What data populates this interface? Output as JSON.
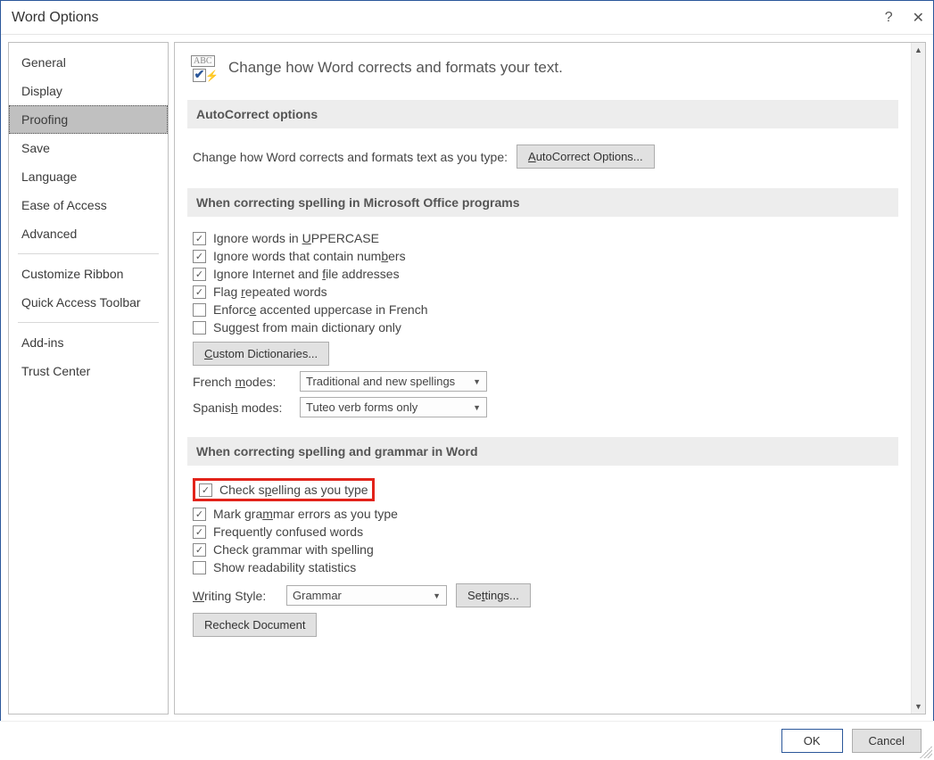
{
  "window": {
    "title": "Word Options"
  },
  "sidebar": {
    "items": [
      {
        "label": "General"
      },
      {
        "label": "Display"
      },
      {
        "label": "Proofing",
        "selected": true
      },
      {
        "label": "Save"
      },
      {
        "label": "Language"
      },
      {
        "label": "Ease of Access"
      },
      {
        "label": "Advanced"
      }
    ],
    "group2": [
      {
        "label": "Customize Ribbon"
      },
      {
        "label": "Quick Access Toolbar"
      }
    ],
    "group3": [
      {
        "label": "Add-ins"
      },
      {
        "label": "Trust Center"
      }
    ]
  },
  "header": {
    "text": "Change how Word corrects and formats your text."
  },
  "section_autocorrect": {
    "title": "AutoCorrect options",
    "desc": "Change how Word corrects and formats text as you type:",
    "button": "AutoCorrect Options..."
  },
  "section_office": {
    "title": "When correcting spelling in Microsoft Office programs",
    "chk_uppercase": "Ignore words in UPPERCASE",
    "chk_numbers": "Ignore words that contain numbers",
    "chk_internet": "Ignore Internet and file addresses",
    "chk_repeated": "Flag repeated words",
    "chk_french": "Enforce accented uppercase in French",
    "chk_maindict": "Suggest from main dictionary only",
    "btn_customdict": "Custom Dictionaries...",
    "lbl_french": "French modes:",
    "dd_french": "Traditional and new spellings",
    "lbl_spanish": "Spanish modes:",
    "dd_spanish": "Tuteo verb forms only"
  },
  "section_word": {
    "title": "When correcting spelling and grammar in Word",
    "chk_spelltype": "Check spelling as you type",
    "chk_grammartype": "Mark grammar errors as you type",
    "chk_confused": "Frequently confused words",
    "chk_grammarspell": "Check grammar with spelling",
    "chk_readability": "Show readability statistics",
    "lbl_writing": "Writing Style:",
    "dd_writing": "Grammar",
    "btn_settings": "Settings...",
    "btn_recheck": "Recheck Document"
  },
  "footer": {
    "ok": "OK",
    "cancel": "Cancel"
  }
}
